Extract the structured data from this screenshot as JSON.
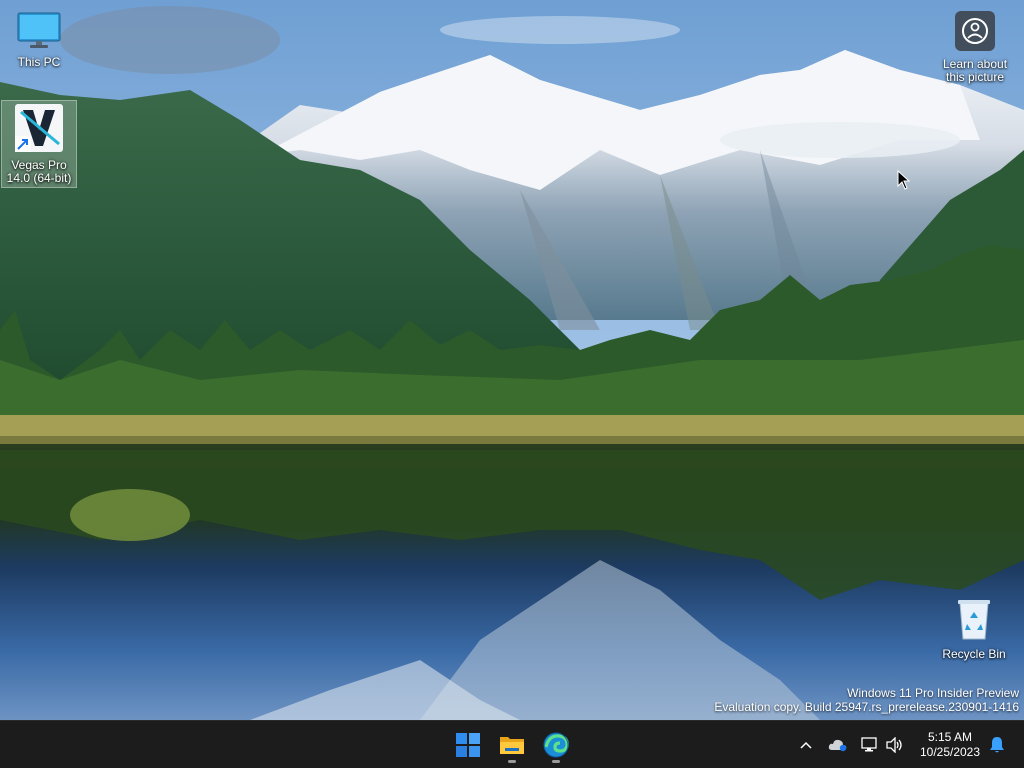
{
  "desktop": {
    "icons": [
      {
        "id": "this-pc",
        "label": "This PC"
      },
      {
        "id": "vegas",
        "label_line1": "Vegas Pro",
        "label_line2": "14.0 (64-bit)"
      },
      {
        "id": "learn",
        "label_line1": "Learn about",
        "label_line2": "this picture"
      },
      {
        "id": "recycle",
        "label": "Recycle Bin"
      }
    ]
  },
  "watermark": {
    "line1": "Windows 11 Pro Insider Preview",
    "line2": "Evaluation copy. Build 25947.rs_prerelease.230901-1416"
  },
  "taskbar": {
    "apps": [
      {
        "name": "Start",
        "icon": "windows-logo-icon"
      },
      {
        "name": "File Explorer",
        "icon": "folder-icon",
        "running": true
      },
      {
        "name": "Microsoft Edge",
        "icon": "edge-icon",
        "running": true
      }
    ],
    "tray": {
      "icons": [
        "chevron-up-icon",
        "onedrive-icon",
        "network-icon",
        "volume-icon",
        "notification-bell-icon"
      ],
      "time": "5:15 AM",
      "date": "10/25/2023"
    }
  },
  "colors": {
    "taskbar_bg": "#1c1c1c",
    "start_blue": "#2f8df0",
    "notify_blue": "#3aa0ff"
  }
}
